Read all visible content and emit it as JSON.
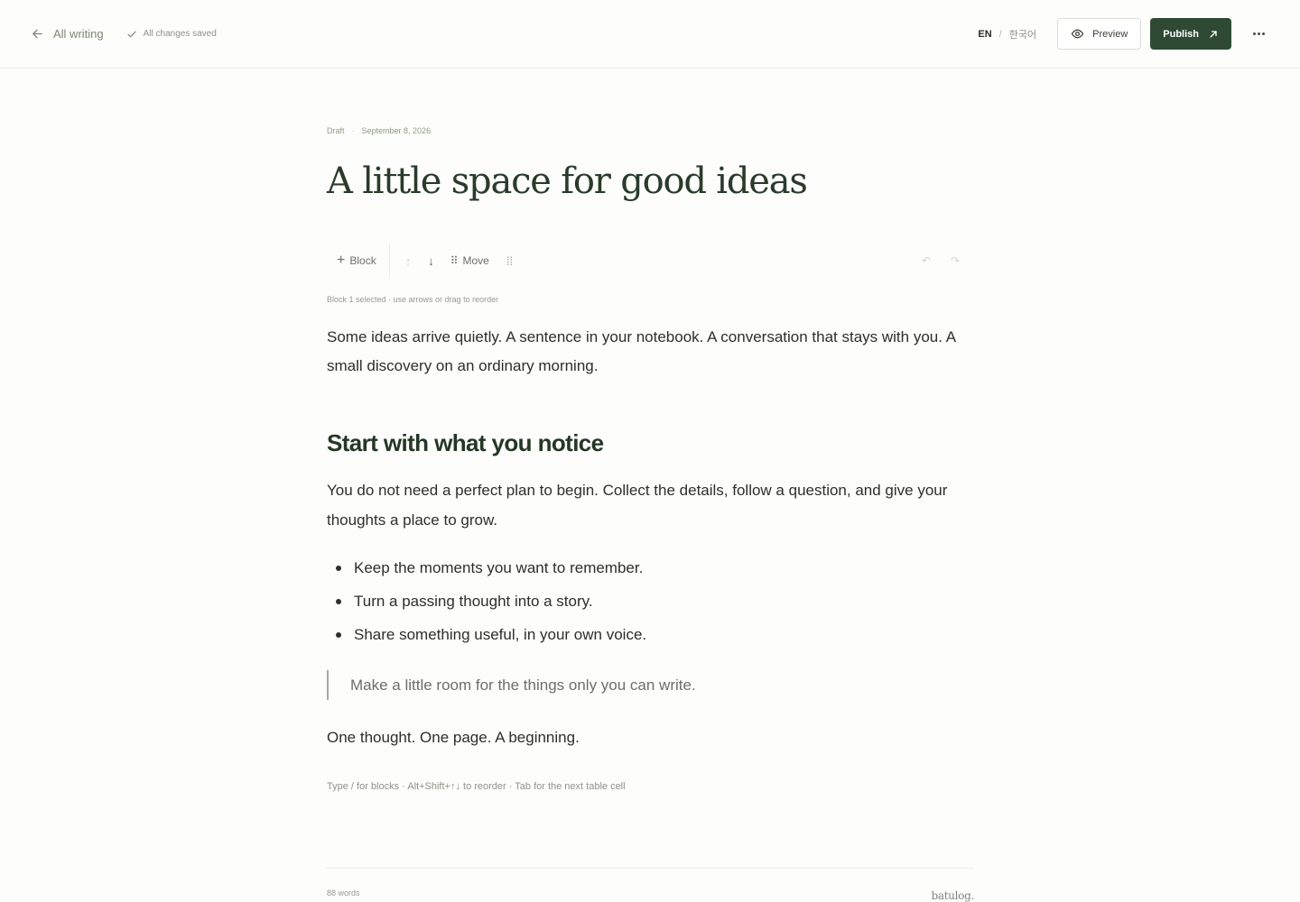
{
  "header": {
    "back_label": "All writing",
    "saved_status": "All changes saved",
    "lang_en": "EN",
    "lang_sep": "/",
    "lang_ko": "한국어",
    "preview_label": "Preview",
    "publish_label": "Publish"
  },
  "doc": {
    "status": "Draft",
    "meta_sep": "·",
    "date": "September 8, 2026",
    "title": "A little space for good ideas"
  },
  "toolbar": {
    "add_label": "Block",
    "move_label": "Move"
  },
  "hint_top": "Block 1 selected · use arrows or drag to reorder",
  "content": {
    "paragraph1": "Some ideas arrive quietly. A sentence in your notebook. A conversation that stays with you. A small discovery on an ordinary morning.",
    "heading": "Start with what you notice",
    "paragraph2": "You do not need a perfect plan to begin. Collect the details, follow a question, and give your thoughts a place to grow.",
    "bullets": [
      "Keep the moments you want to remember.",
      "Turn a passing thought into a story.",
      "Share something useful, in your own voice."
    ],
    "quote": "Make a little room for the things only you can write.",
    "paragraph3": "One thought. One page. A beginning."
  },
  "hint_bottom": "Type / for blocks · Alt+Shift+↑↓ to reorder · Tab for the next table cell",
  "footer": {
    "word_count": "88 words",
    "brand": "batulog."
  },
  "colors": {
    "accent": "#2f4a34",
    "background": "#fdfdfc"
  },
  "icons": [
    "arrow-left-icon",
    "check-icon",
    "eye-icon",
    "arrow-up-right-icon",
    "more-horizontal-icon",
    "plus-icon",
    "arrow-up-icon",
    "arrow-down-icon",
    "drag-handle-icon",
    "undo-icon",
    "redo-icon"
  ]
}
